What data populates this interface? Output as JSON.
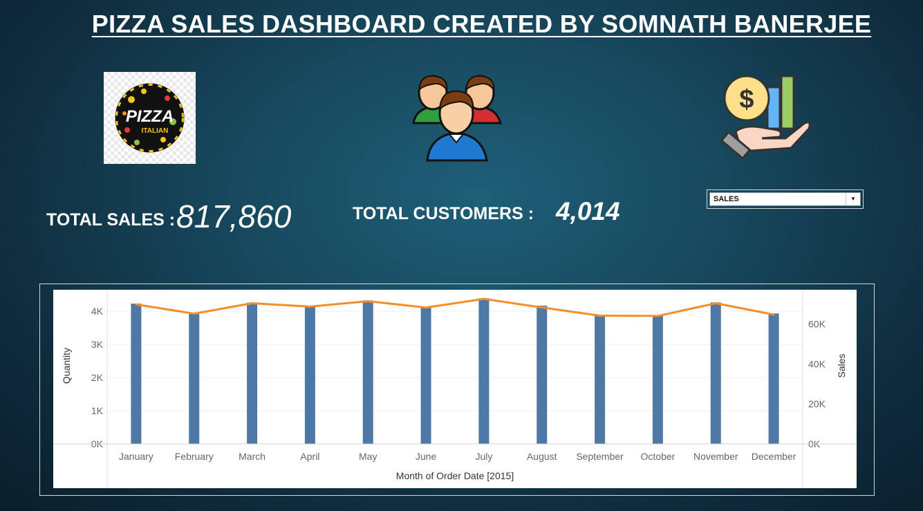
{
  "header": {
    "title": "PIZZA SALES DASHBOARD CREATED BY SOMNATH BANERJEE"
  },
  "logo": {
    "text_main": "PIZZA",
    "text_sub": "ITALIAN"
  },
  "icons": {
    "logo": "pizza-logo-icon",
    "customers": "users-group-icon",
    "sales": "money-hand-chart-icon"
  },
  "kpis": {
    "sales_label": "TOTAL SALES :",
    "sales_value": "817,860",
    "customers_label": "TOTAL CUSTOMERS :",
    "customers_value": "4,014"
  },
  "selector": {
    "value": "SALES",
    "arrow": "▼"
  },
  "colors": {
    "bar": "#4e79a7",
    "line": "#f28e2b",
    "title": "#ffffff"
  },
  "chart_data": {
    "type": "bar",
    "categories": [
      "January",
      "February",
      "March",
      "April",
      "May",
      "June",
      "July",
      "August",
      "September",
      "October",
      "November",
      "December"
    ],
    "series": [
      {
        "name": "Quantity",
        "kind": "bar",
        "axis": "left",
        "values": [
          4232,
          3961,
          4261,
          4151,
          4328,
          4107,
          4392,
          4168,
          3890,
          3883,
          4266,
          3935
        ]
      },
      {
        "name": "Sales",
        "kind": "line",
        "axis": "right",
        "values": [
          69793,
          65160,
          70397,
          68737,
          71403,
          68230,
          72558,
          68278,
          64180,
          64028,
          70395,
          64701
        ]
      }
    ],
    "xlabel": "Month of Order Date [2015]",
    "ylabel": "Quantity",
    "y2label": "Sales",
    "ylim": [
      0,
      4400
    ],
    "y2lim": [
      0,
      73000
    ],
    "yticks": [
      0,
      1000,
      2000,
      3000,
      4000
    ],
    "ytick_labels": [
      "0K",
      "1K",
      "2K",
      "3K",
      "4K"
    ],
    "y2ticks": [
      0,
      20000,
      40000,
      60000
    ],
    "y2tick_labels": [
      "0K",
      "20K",
      "40K",
      "60K"
    ],
    "grid": true
  }
}
